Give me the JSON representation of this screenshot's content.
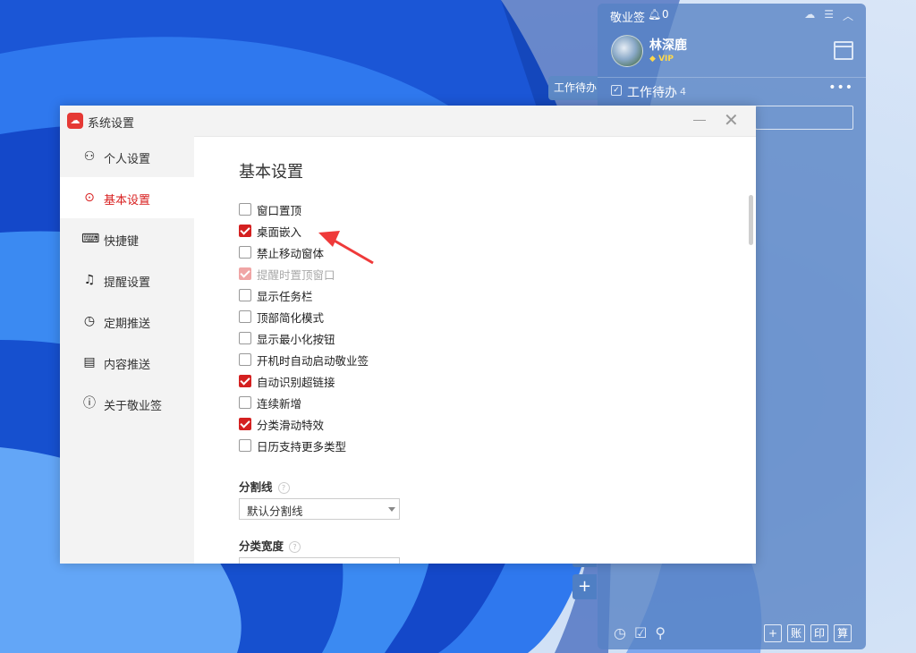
{
  "widget": {
    "brand": "敬业签",
    "notifications": "0",
    "user": {
      "name": "林深鹿",
      "badge": "VIP"
    },
    "todo": {
      "title": "工作待办",
      "count": "4"
    },
    "tab_label": "工作待办",
    "bottom_right": [
      "+",
      "账",
      "印",
      "算"
    ]
  },
  "dialog": {
    "title": "系统设置",
    "nav": [
      {
        "label": "个人设置",
        "icon": "person-icon"
      },
      {
        "label": "基本设置",
        "icon": "target-icon",
        "active": true
      },
      {
        "label": "快捷键",
        "icon": "keyboard-icon"
      },
      {
        "label": "提醒设置",
        "icon": "bell-icon"
      },
      {
        "label": "定期推送",
        "icon": "clock-icon"
      },
      {
        "label": "内容推送",
        "icon": "document-icon"
      },
      {
        "label": "关于敬业签",
        "icon": "info-icon"
      }
    ],
    "section_title": "基本设置",
    "options": [
      {
        "label": "窗口置顶",
        "checked": false
      },
      {
        "label": "桌面嵌入",
        "checked": true
      },
      {
        "label": "禁止移动窗体",
        "checked": false
      },
      {
        "label": "提醒时置顶窗口",
        "checked": true,
        "disabled": true
      },
      {
        "label": "显示任务栏",
        "checked": false
      },
      {
        "label": "顶部简化模式",
        "checked": false
      },
      {
        "label": "显示最小化按钮",
        "checked": false
      },
      {
        "label": "开机时自动启动敬业签",
        "checked": false
      },
      {
        "label": "自动识别超链接",
        "checked": true
      },
      {
        "label": "连续新增",
        "checked": false
      },
      {
        "label": "分类滑动特效",
        "checked": true
      },
      {
        "label": "日历支持更多类型",
        "checked": false
      }
    ],
    "divider": {
      "label": "分割线",
      "value": "默认分割线"
    },
    "category_width": {
      "label": "分类宽度"
    }
  },
  "colors": {
    "accent": "#d42020",
    "widget_bg": "#5682c4"
  }
}
